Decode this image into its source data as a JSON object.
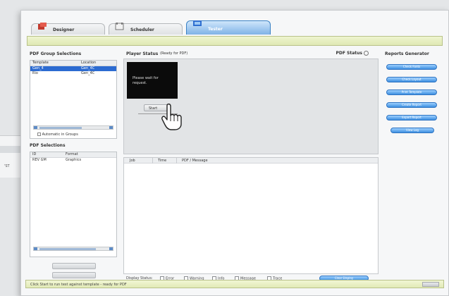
{
  "outer": {
    "left_text": "'ST"
  },
  "tabs": [
    {
      "label": "Designer",
      "active": false
    },
    {
      "label": "Scheduler",
      "active": false
    },
    {
      "label": "Tester",
      "active": true
    }
  ],
  "left": {
    "group_title": "PDF Group Selections",
    "group_table": {
      "headers": [
        "Template",
        "Location"
      ],
      "rows": [
        {
          "c1": "Gen_4",
          "c2": "Gen_4C",
          "selected": true
        },
        {
          "c1": "Rio",
          "c2": "Gen_4C",
          "selected": false
        }
      ]
    },
    "group_checkbox_label": "Automatic in Groups",
    "selections_title": "PDF Selections",
    "selections_table": {
      "headers": [
        "ID",
        "Format"
      ],
      "rows": [
        {
          "c1": "REV GM",
          "c2": "Graphics"
        }
      ]
    }
  },
  "player": {
    "title": "Player Status",
    "status_text": "(Ready for PDF)",
    "screen_text_1": "Please wait for",
    "screen_text_2": "request.",
    "start_button": "Start",
    "pdf_status_label": "PDF Status"
  },
  "log": {
    "headers": [
      "Job",
      "Time",
      "PDF / Message"
    ]
  },
  "filters": {
    "label": "Display Status:",
    "items": [
      "Error",
      "Warning",
      "Info",
      "Message",
      "Trace"
    ],
    "clear_button": "Clear Display"
  },
  "reports": {
    "title": "Reports Generator",
    "buttons": [
      "Check Fonts",
      "Check Layout",
      "Print Template",
      "Create Report",
      "Export Report",
      "View Log"
    ]
  },
  "status_bar": {
    "text": "Click Start to run test against template - ready for PDF"
  },
  "colors": {
    "accent": "#3d8fe0",
    "status_bar": "#e2eab7",
    "selection": "#2c6bd1"
  }
}
